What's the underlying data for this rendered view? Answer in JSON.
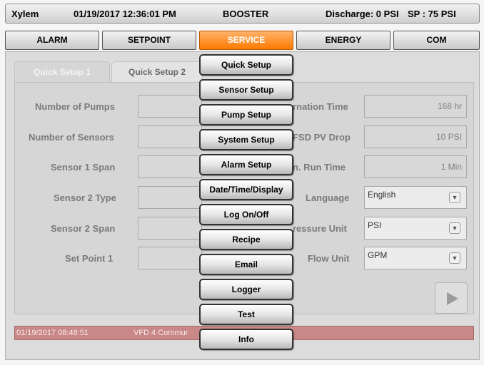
{
  "topbar": {
    "brand": "Xylem",
    "datetime": "01/19/2017 12:36:01 PM",
    "mode": "BOOSTER",
    "discharge": "Discharge: 0 PSI",
    "setpoint": "SP : 75 PSI"
  },
  "tabs": {
    "alarm": "ALARM",
    "setpoint": "SETPOINT",
    "service": "SERVICE",
    "energy": "ENERGY",
    "com": "COM"
  },
  "subtabs": {
    "quick1": "Quick Setup 1",
    "quick2": "Quick Setup 2"
  },
  "left_labels": {
    "pumps": "Number of Pumps",
    "sensors": "Number of Sensors",
    "span1": "Sensor 1 Span",
    "type2": "Sensor 2 Type",
    "span2": "Sensor 2 Span",
    "sp1": "Set Point 1"
  },
  "right_labels": {
    "alternation": "rnation Time",
    "vfd_drop": "FSD PV Drop",
    "run_time": "n. Run Time",
    "language": "Language",
    "pressure_unit": "ressure Unit",
    "flow_unit": "Flow Unit"
  },
  "right_values": {
    "alternation": "168 hr",
    "vfd_drop": "10 PSI",
    "run_time": "1 Min"
  },
  "selects": {
    "language": "English",
    "pressure_unit": "PSI",
    "flow_unit": "GPM"
  },
  "alarm_banner": {
    "timestamp": "01/19/2017 08:48:51",
    "message": "VFD 4 Commur"
  },
  "service_menu": {
    "items": [
      "Quick Setup",
      "Sensor Setup",
      "Pump Setup",
      "System Setup",
      "Alarm Setup",
      "Date/Time/Display",
      "Log On/Off",
      "Recipe",
      "Email",
      "Logger",
      "Test",
      "Info"
    ]
  },
  "icons": {
    "select_arrow": "chevron-down-icon",
    "next": "play-arrow-icon"
  },
  "colors": {
    "active_tab": "#ff8c1a",
    "alarm_banner": "#c98888"
  }
}
